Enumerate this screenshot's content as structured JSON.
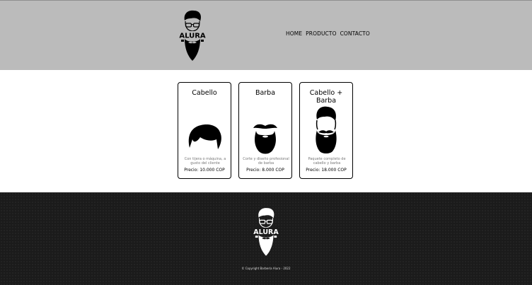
{
  "header": {
    "logo_text": "ALURA",
    "nav": [
      "HOME",
      "PRODUCTO",
      "CONTACTO"
    ]
  },
  "cards": [
    {
      "title": "Cabello",
      "icon": "hair-icon",
      "description": "Con tijera o máquina, a gusto del cliente",
      "price": "Precio: 10.000 COP"
    },
    {
      "title": "Barba",
      "icon": "beard-icon",
      "description": "Corte y diseño profesional de barba",
      "price": "Precio: 8.000 COP"
    },
    {
      "title": "Cabello + Barba",
      "icon": "hair-beard-icon",
      "description": "Paquete completo de cabello y barba",
      "price": "Precio: 18.000 COP"
    }
  ],
  "footer": {
    "logo_text": "ALURA",
    "copyright": "© Copyright Barbería Alura - 2022"
  },
  "colors": {
    "header_bg": "#bbbbbb",
    "footer_bg": "#1b1b1b",
    "card_border": "#000000"
  }
}
